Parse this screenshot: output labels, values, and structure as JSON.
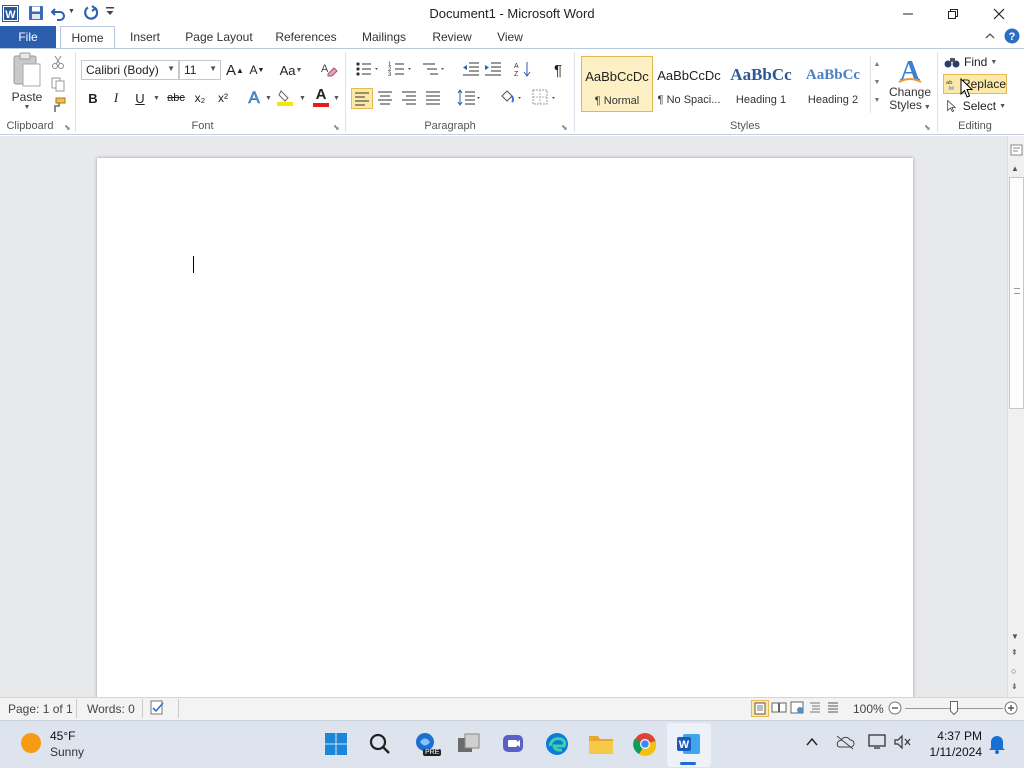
{
  "window": {
    "title": "Document1  -  Microsoft Word"
  },
  "tabs": {
    "file": "File",
    "home": "Home",
    "insert": "Insert",
    "page_layout": "Page Layout",
    "references": "References",
    "mailings": "Mailings",
    "review": "Review",
    "view": "View"
  },
  "clipboard": {
    "paste": "Paste",
    "label": "Clipboard"
  },
  "font": {
    "name": "Calibri (Body)",
    "size": "11",
    "grow": "A",
    "shrink": "A",
    "case": "Aa",
    "bold": "B",
    "italic": "I",
    "underline": "U",
    "strike": "abc",
    "subscript": "x₂",
    "superscript": "x²",
    "effects": "A",
    "color": "A",
    "label": "Font"
  },
  "paragraph": {
    "pilcrow": "¶",
    "label": "Paragraph"
  },
  "styles": {
    "items": [
      {
        "preview": "AaBbCcDc",
        "label": "¶ Normal"
      },
      {
        "preview": "AaBbCcDc",
        "label": "¶ No Spaci..."
      },
      {
        "preview": "AaBbCc",
        "label": "Heading 1"
      },
      {
        "preview": "AaBbCc",
        "label": "Heading 2"
      }
    ],
    "change_line1": "Change",
    "change_line2": "Styles",
    "label": "Styles"
  },
  "editing": {
    "find": "Find",
    "replace": "Replace",
    "select": "Select",
    "label": "Editing"
  },
  "status": {
    "page": "Page: 1 of 1",
    "words": "Words: 0",
    "zoom": "100%"
  },
  "taskbar": {
    "temp": "45°F",
    "condition": "Sunny",
    "time": "4:37 PM",
    "date": "1/11/2024",
    "pre_badge": "PRE"
  },
  "colors": {
    "file_tab": "#2b5fad",
    "accent_blue": "#2b579a",
    "selected_hl": "#fbe9a8",
    "font_color_red": "#e02020",
    "highlight_yellow": "#f5e600"
  }
}
